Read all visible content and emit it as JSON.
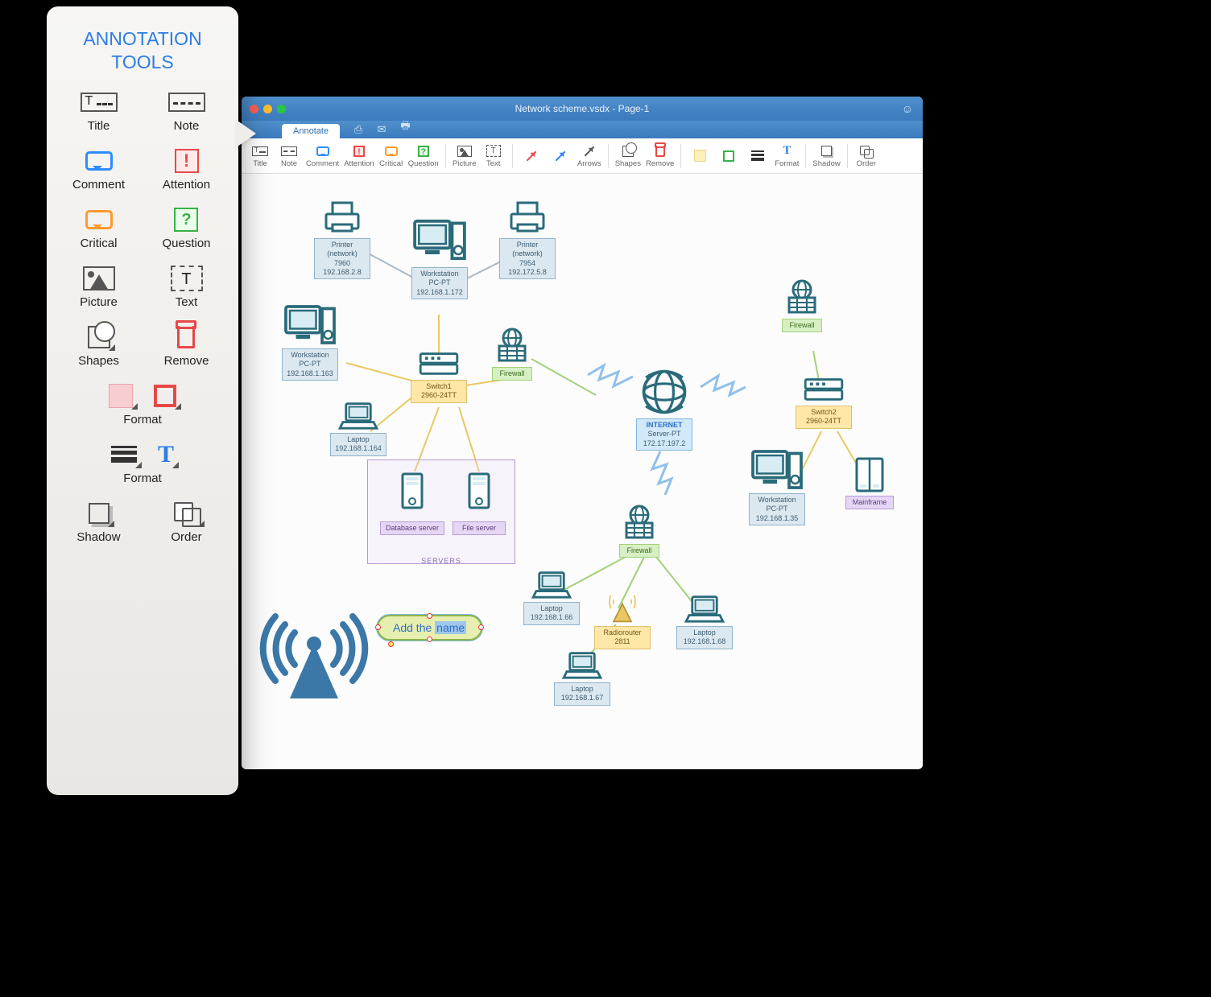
{
  "window": {
    "title": "Network scheme.vsdx - Page-1"
  },
  "tabbar": {
    "active": "Annotate"
  },
  "toolbar": {
    "title": "Title",
    "note": "Note",
    "comment": "Comment",
    "attention": "Attention",
    "critical": "Critical",
    "question": "Question",
    "picture": "Picture",
    "text": "Text",
    "arrows": "Arrows",
    "shapes": "Shapes",
    "remove": "Remove",
    "format": "Format",
    "shadow": "Shadow",
    "order": "Order"
  },
  "callout": {
    "heading_l1": "ANNOTATION",
    "heading_l2": "TOOLS",
    "items": {
      "title": "Title",
      "note": "Note",
      "comment": "Comment",
      "attention": "Attention",
      "critical": "Critical",
      "question": "Question",
      "picture": "Picture",
      "text": "Text",
      "shapes": "Shapes",
      "remove": "Remove",
      "format": "Format",
      "shadow": "Shadow",
      "order": "Order"
    }
  },
  "annotation_bubble": {
    "prefix": "Add the ",
    "highlight": "name"
  },
  "nodes": {
    "printer1": {
      "l1": "Printer",
      "l2": "(network)",
      "l3": "7960",
      "l4": "192.168.2.8"
    },
    "printer2": {
      "l1": "Printer",
      "l2": "(network)",
      "l3": "7954",
      "l4": "192.172.5.8"
    },
    "workstation1": {
      "l1": "Workstation",
      "l2": "PC-PT",
      "l3": "192.168.1.172"
    },
    "firewall1": {
      "l": "Firewall"
    },
    "workstation2": {
      "l1": "Workstation",
      "l2": "PC-PT",
      "l3": "192.168.1.163"
    },
    "switch1": {
      "l1": "Switch1",
      "l2": "2960-24TT"
    },
    "laptop1": {
      "l1": "Laptop",
      "l2": "192.168.1.164"
    },
    "dbserver": {
      "l": "Database server"
    },
    "fileserver": {
      "l": "File server"
    },
    "servers_box": {
      "l": "SERVERS"
    },
    "internet": {
      "l1": "INTERNET",
      "l2": "Server-PT",
      "l3": "172.17.197.2"
    },
    "firewall2": {
      "l": "Firewall"
    },
    "switch2": {
      "l1": "Switch2",
      "l2": "2960-24TT"
    },
    "firewall3": {
      "l": "Firewall"
    },
    "workstation3": {
      "l1": "Workstation",
      "l2": "PC-PT",
      "l3": "192.168.1.35"
    },
    "mainframe": {
      "l": "Mainframe"
    },
    "laptop2": {
      "l1": "Laptop",
      "l2": "192.168.1.66"
    },
    "radiorouter": {
      "l1": "Radiorouter",
      "l2": "2811"
    },
    "laptop3": {
      "l1": "Laptop",
      "l2": "192.168.1.68"
    },
    "laptop4": {
      "l1": "Laptop",
      "l2": "192.168.1.67"
    }
  }
}
